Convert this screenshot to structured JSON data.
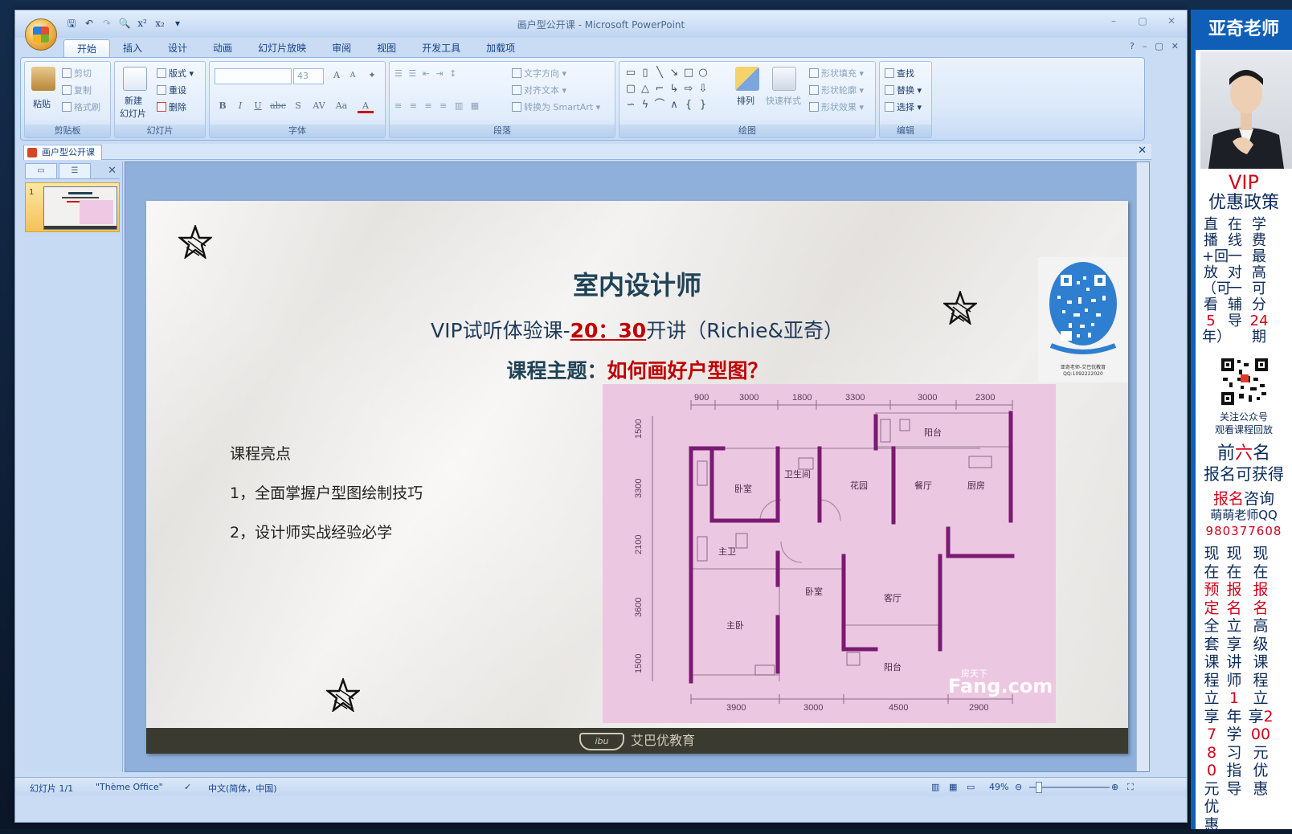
{
  "window": {
    "title": "画户型公开课 - Microsoft PowerPoint",
    "doc_tab": "画户型公开课"
  },
  "ribbon_tabs": [
    "开始",
    "插入",
    "设计",
    "动画",
    "幻灯片放映",
    "审阅",
    "视图",
    "开发工具",
    "加载项"
  ],
  "ribbon": {
    "clipboard": {
      "label": "剪贴板",
      "paste": "粘贴",
      "cut": "剪切",
      "copy": "复制",
      "format_painter": "格式刷"
    },
    "slides": {
      "label": "幻灯片",
      "new_slide_1": "新建",
      "new_slide_2": "幻灯片",
      "layout": "版式",
      "reset": "重设",
      "delete": "删除"
    },
    "font": {
      "label": "字体",
      "size": "43",
      "bold": "B",
      "italic": "I",
      "underline": "U",
      "strike": "abc",
      "shadow": "S",
      "spacing": "AV",
      "case": "Aa",
      "grow": "A",
      "shrink": "A"
    },
    "paragraph": {
      "label": "段落",
      "text_direction": "文字方向",
      "align_text": "对齐文本",
      "convert_smartart": "转换为 SmartArt"
    },
    "drawing": {
      "label": "绘图",
      "arrange": "排列",
      "quick_styles": "快速样式",
      "shape_fill": "形状填充",
      "shape_outline": "形状轮廓",
      "shape_effects": "形状效果"
    },
    "editing": {
      "label": "编辑",
      "find": "查找",
      "replace": "替换",
      "select": "选择"
    }
  },
  "slides_pane": {
    "thumb_number": "1"
  },
  "slide": {
    "title": "室内设计师",
    "subtitle_prefix": "VIP试听体验课-",
    "subtitle_time": "20：30",
    "subtitle_suffix": "开讲（Richie&亚奇）",
    "topic_prefix": "课程主题：",
    "topic_red": "如何画好户型图？",
    "highlights_title": "课程亮点",
    "highlight_1": "1，全面掌握户型图绘制技巧",
    "highlight_2": "2，设计师实战经验必学",
    "qr_caption_1": "亚奇老师-艾巴优教育",
    "qr_caption_2": "QQ:1092222020",
    "footer": "艾巴优教育",
    "footer_logo": "ibu",
    "floor_plan": {
      "top_dims": [
        "900",
        "3000",
        "1800",
        "3300",
        "3000",
        "2300"
      ],
      "bottom_dims": [
        "3900",
        "3000",
        "4500",
        "2900"
      ],
      "left_dims": [
        "1500",
        "3300",
        "2100",
        "3600",
        "1500"
      ],
      "rooms": {
        "balcony_top": "阳台",
        "bedroom_1": "卧室",
        "bathroom": "卫生间",
        "garden": "花园",
        "dining": "餐厅",
        "kitchen": "厨房",
        "master_bath": "主卫",
        "bedroom_2": "卧室",
        "living": "客厅",
        "master_bedroom": "主卧",
        "balcony_bottom": "阳台"
      },
      "watermark_1": "房天下",
      "watermark_2": "Fang.com"
    }
  },
  "status_bar": {
    "slide_count": "幻灯片 1/1",
    "theme": "\"Thème Office\"",
    "language": "中文(简体，中国)",
    "zoom": "49%"
  },
  "ad": {
    "header": "亚奇老师",
    "vip": "VIP",
    "policy": "优惠政策",
    "col1": "直播+回放（可看",
    "col1_red": "5",
    "col1_end": "年）",
    "col2": "在线一对一辅导",
    "col3_a": "学费最高可分",
    "col3_red": "24",
    "col3_b": "期",
    "follow_1": "关注公众号",
    "follow_2": "观看课程回放",
    "first_a": "前",
    "first_red": "六",
    "first_b": "名",
    "first_line2": "报名可获得",
    "consult_red": "报名",
    "consult": "咨询",
    "teacher_qq": "萌萌老师QQ",
    "qq_number": "980377608",
    "b1_a": "现在",
    "b1_red": "预定",
    "b1_b": "全套课程立享",
    "b1_red2": "780",
    "b1_c": "元优惠",
    "b2_a": "现在",
    "b2_red": "报名",
    "b2_b": "立享讲师",
    "b2_red2": "1",
    "b2_c": "年学习指导",
    "b3_a": "现在",
    "b3_red": "报名",
    "b3_b": "高级课程立享",
    "b3_red2": "200",
    "b3_c": "元优惠"
  },
  "colors": {
    "accent_red": "#c00000",
    "title_teal": "#1f4357",
    "ribbon_blue": "#15428b",
    "plan_pink": "#ecc7e1",
    "wall_purple": "#7a1a73",
    "ad_blue": "#0f5fb8"
  }
}
